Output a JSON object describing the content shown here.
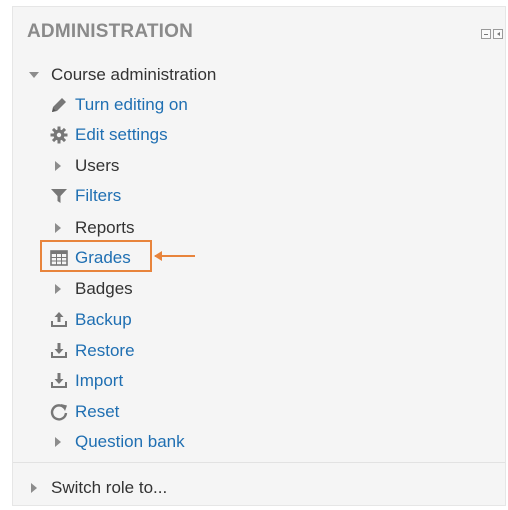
{
  "block": {
    "title": "ADMINISTRATION"
  },
  "menu": {
    "course_admin_label": "Course administration",
    "items": [
      {
        "label": "Turn editing on",
        "icon": "pencil-icon",
        "type": "link"
      },
      {
        "label": "Edit settings",
        "icon": "gear-icon",
        "type": "link"
      },
      {
        "label": "Users",
        "icon": "caret-right-icon",
        "type": "expandable"
      },
      {
        "label": "Filters",
        "icon": "filter-icon",
        "type": "link"
      },
      {
        "label": "Reports",
        "icon": "caret-right-icon",
        "type": "expandable"
      },
      {
        "label": "Grades",
        "icon": "grades-table-icon",
        "type": "link",
        "highlighted": true
      },
      {
        "label": "Badges",
        "icon": "caret-right-icon",
        "type": "expandable"
      },
      {
        "label": "Backup",
        "icon": "backup-icon",
        "type": "link"
      },
      {
        "label": "Restore",
        "icon": "restore-icon",
        "type": "link"
      },
      {
        "label": "Import",
        "icon": "import-icon",
        "type": "link"
      },
      {
        "label": "Reset",
        "icon": "reset-icon",
        "type": "link"
      },
      {
        "label": "Question bank",
        "icon": "caret-right-icon",
        "type": "expandable"
      }
    ],
    "switch_role_label": "Switch role to..."
  },
  "colors": {
    "link": "#1f6fb2",
    "text": "#333333",
    "highlight": "#e8843c"
  }
}
